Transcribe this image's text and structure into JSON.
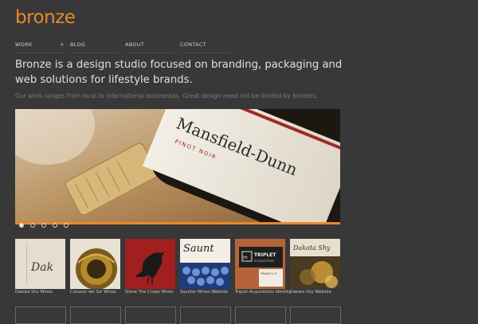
{
  "logo": "bronze",
  "nav": [
    {
      "label": "WORK",
      "indicator": "+"
    },
    {
      "label": "BLOG"
    },
    {
      "label": "ABOUT"
    },
    {
      "label": "CONTACT"
    }
  ],
  "headline": "Bronze is a design studio focused on branding, packaging and web solutions for lifestyle brands.",
  "subline": "Our work ranges from local to international businesses. Great design need not be limited by borders.",
  "hero": {
    "bottle_label": "Mansfield-Dunn",
    "bottle_sublabel": "PINOT NOIR",
    "slide_count": 5,
    "active_slide": 1
  },
  "thumbnails": [
    {
      "caption": "Dakota Shy Wines",
      "art_text": "Dak"
    },
    {
      "caption": "Corazon del Sol Wines"
    },
    {
      "caption": "Stone The Crows Wines"
    },
    {
      "caption": "Saunter Wines Website",
      "art_text": "Saunt"
    },
    {
      "caption": "Triplet Acquisitions Identity",
      "art_text": "TRIPLET",
      "art_subtext": "ACQUISITIONS",
      "art_mono": "ttt",
      "art_small": "TRAVIS & TI"
    },
    {
      "caption": "Dakota Shy Website",
      "art_text": "Dakota Shy"
    }
  ],
  "colors": {
    "accent": "#e8892a",
    "background": "#383838"
  }
}
